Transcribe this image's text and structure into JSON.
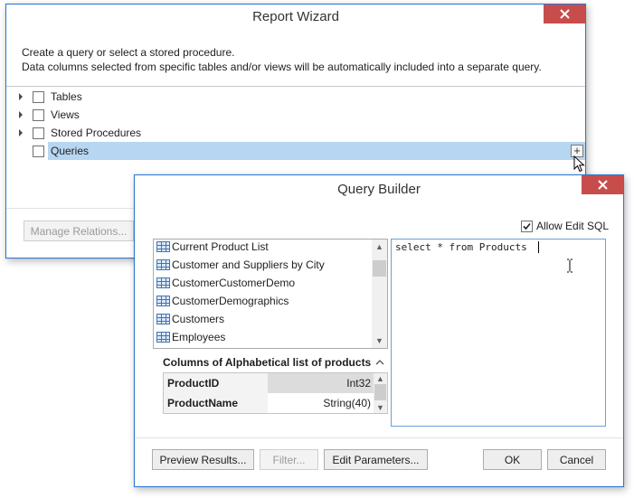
{
  "report_wizard": {
    "title": "Report Wizard",
    "description_line1": "Create a query or select a stored procedure.",
    "description_line2": "Data columns selected from specific tables and/or views will be automatically included into a separate query.",
    "tree": [
      {
        "label": "Tables",
        "expandable": true
      },
      {
        "label": "Views",
        "expandable": true
      },
      {
        "label": "Stored Procedures",
        "expandable": true
      },
      {
        "label": "Queries",
        "expandable": false,
        "selected": true
      }
    ],
    "add_glyph": "+",
    "manage_relations_label": "Manage Relations..."
  },
  "query_builder": {
    "title": "Query Builder",
    "allow_edit_sql_label": "Allow Edit SQL",
    "allow_edit_sql_checked": true,
    "tables": [
      "Current Product List",
      "Customer and Suppliers by City",
      "CustomerCustomerDemo",
      "CustomerDemographics",
      "Customers",
      "Employees"
    ],
    "columns_header": "Columns of Alphabetical list of products",
    "columns": [
      {
        "name": "ProductID",
        "type": "Int32"
      },
      {
        "name": "ProductName",
        "type": "String(40)"
      }
    ],
    "sql_text": "select * from Products",
    "buttons": {
      "preview": "Preview Results...",
      "filter": "Filter...",
      "edit_parameters": "Edit Parameters...",
      "ok": "OK",
      "cancel": "Cancel"
    }
  },
  "colors": {
    "window_border": "#2b79d6",
    "close_button": "#c74d4d",
    "selection": "#b7d6f2",
    "scroll_thumb": "#cdcdcd"
  },
  "icons": {
    "close": "close-icon",
    "table": "table-icon",
    "expand": "expand-arrow-icon",
    "cursor": "mouse-pointer-icon",
    "text_cursor": "text-cursor-icon"
  }
}
